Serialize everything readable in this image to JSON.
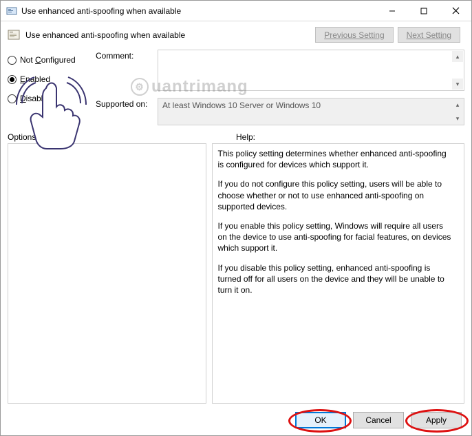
{
  "window": {
    "title": "Use enhanced anti-spoofing when available"
  },
  "header": {
    "policy_name": "Use enhanced anti-spoofing when available",
    "previous": "Previous Setting",
    "next": "Next Setting"
  },
  "labels": {
    "comment": "Comment:",
    "supported": "Supported on:",
    "options": "Options:",
    "help": "Help:"
  },
  "radios": {
    "not_configured": "Not Configured",
    "enabled": "Enabled",
    "disabled": "Disabled",
    "selected": "enabled"
  },
  "comment_value": "",
  "supported_value": "At least Windows 10 Server or Windows 10",
  "help": {
    "p1": "This policy setting determines whether enhanced anti-spoofing is configured for devices which support it.",
    "p2": "If you do not configure this policy setting, users will be able to choose whether or not to use enhanced anti-spoofing on supported devices.",
    "p3": "If you enable this policy setting, Windows will require all users on the device to use anti-spoofing for facial features, on devices which support it.",
    "p4": "If you disable this policy setting, enhanced anti-spoofing is turned off for all users on the device and they will be unable to turn it on."
  },
  "buttons": {
    "ok": "OK",
    "cancel": "Cancel",
    "apply": "Apply"
  },
  "watermark": "uantrimang"
}
